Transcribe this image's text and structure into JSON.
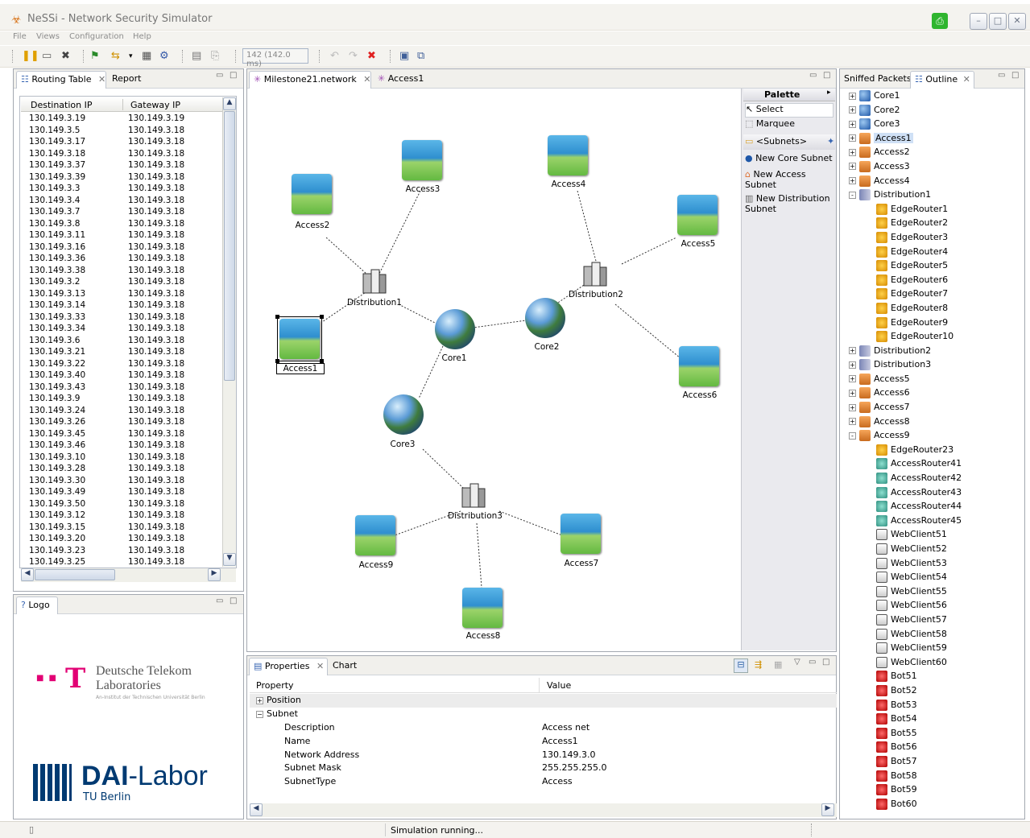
{
  "window": {
    "title": "NeSSi - Network Security Simulator"
  },
  "menu": [
    "File",
    "Views",
    "Configuration",
    "Help"
  ],
  "toolbar": {
    "speed_label": "142 (142.0 ms)"
  },
  "routing_panel": {
    "tabs": [
      "Routing Table",
      "Report"
    ],
    "columns": [
      "Destination IP",
      "Gateway IP"
    ],
    "rows": [
      [
        "130.149.3.19",
        "130.149.3.19"
      ],
      [
        "130.149.3.5",
        "130.149.3.18"
      ],
      [
        "130.149.3.17",
        "130.149.3.18"
      ],
      [
        "130.149.3.18",
        "130.149.3.18"
      ],
      [
        "130.149.3.37",
        "130.149.3.18"
      ],
      [
        "130.149.3.39",
        "130.149.3.18"
      ],
      [
        "130.149.3.3",
        "130.149.3.18"
      ],
      [
        "130.149.3.4",
        "130.149.3.18"
      ],
      [
        "130.149.3.7",
        "130.149.3.18"
      ],
      [
        "130.149.3.8",
        "130.149.3.18"
      ],
      [
        "130.149.3.11",
        "130.149.3.18"
      ],
      [
        "130.149.3.16",
        "130.149.3.18"
      ],
      [
        "130.149.3.36",
        "130.149.3.18"
      ],
      [
        "130.149.3.38",
        "130.149.3.18"
      ],
      [
        "130.149.3.2",
        "130.149.3.18"
      ],
      [
        "130.149.3.13",
        "130.149.3.18"
      ],
      [
        "130.149.3.14",
        "130.149.3.18"
      ],
      [
        "130.149.3.33",
        "130.149.3.18"
      ],
      [
        "130.149.3.34",
        "130.149.3.18"
      ],
      [
        "130.149.3.6",
        "130.149.3.18"
      ],
      [
        "130.149.3.21",
        "130.149.3.18"
      ],
      [
        "130.149.3.22",
        "130.149.3.18"
      ],
      [
        "130.149.3.40",
        "130.149.3.18"
      ],
      [
        "130.149.3.43",
        "130.149.3.18"
      ],
      [
        "130.149.3.9",
        "130.149.3.18"
      ],
      [
        "130.149.3.24",
        "130.149.3.18"
      ],
      [
        "130.149.3.26",
        "130.149.3.18"
      ],
      [
        "130.149.3.45",
        "130.149.3.18"
      ],
      [
        "130.149.3.46",
        "130.149.3.18"
      ],
      [
        "130.149.3.10",
        "130.149.3.18"
      ],
      [
        "130.149.3.28",
        "130.149.3.18"
      ],
      [
        "130.149.3.30",
        "130.149.3.18"
      ],
      [
        "130.149.3.49",
        "130.149.3.18"
      ],
      [
        "130.149.3.50",
        "130.149.3.18"
      ],
      [
        "130.149.3.12",
        "130.149.3.18"
      ],
      [
        "130.149.3.15",
        "130.149.3.18"
      ],
      [
        "130.149.3.20",
        "130.149.3.18"
      ],
      [
        "130.149.3.23",
        "130.149.3.18"
      ],
      [
        "130.149.3.25",
        "130.149.3.18"
      ]
    ]
  },
  "logo_panel": {
    "tab": "Logo",
    "telekom_line1": "Deutsche Telekom",
    "telekom_line2": "Laboratories",
    "telekom_sub": "An-Institut der Technischen Universität Berlin",
    "dai_bold": "DAI",
    "dai_rest": "-Labor",
    "dai_sub": "TU Berlin"
  },
  "editor": {
    "tabs": [
      "Milestone21.network",
      "Access1"
    ],
    "nodes": {
      "access1": "Access1",
      "access2": "Access2",
      "access3": "Access3",
      "access4": "Access4",
      "access5": "Access5",
      "access6": "Access6",
      "access7": "Access7",
      "access8": "Access8",
      "access9": "Access9",
      "core1": "Core1",
      "core2": "Core2",
      "core3": "Core3",
      "dist1": "Distribution1",
      "dist2": "Distribution2",
      "dist3": "Distribution3"
    }
  },
  "palette": {
    "title": "Palette",
    "select": "Select",
    "marquee": "Marquee",
    "subnets": "<Subnets>",
    "new_core": "New Core Subnet",
    "new_access": "New Access Subnet",
    "new_distribution": "New Distribution Subnet"
  },
  "properties": {
    "tabs": [
      "Properties",
      "Chart"
    ],
    "columns": [
      "Property",
      "Value"
    ],
    "position": "Position",
    "subnet": "Subnet",
    "rows": [
      [
        "Description",
        "Access net"
      ],
      [
        "Name",
        "Access1"
      ],
      [
        "Network Address",
        "130.149.3.0"
      ],
      [
        "Subnet Mask",
        "255.255.255.0"
      ],
      [
        "SubnetType",
        "Access"
      ]
    ]
  },
  "outline": {
    "tabs": [
      "Sniffed Packets",
      "Outline"
    ],
    "items": [
      {
        "label": "Core1",
        "type": "core",
        "expander": "+",
        "indent": 0
      },
      {
        "label": "Core2",
        "type": "core",
        "expander": "+",
        "indent": 0
      },
      {
        "label": "Core3",
        "type": "core",
        "expander": "+",
        "indent": 0
      },
      {
        "label": "Access1",
        "type": "access",
        "expander": "+",
        "indent": 0
      },
      {
        "label": "Access2",
        "type": "access",
        "expander": "+",
        "indent": 0
      },
      {
        "label": "Access3",
        "type": "access",
        "expander": "+",
        "indent": 0
      },
      {
        "label": "Access4",
        "type": "access",
        "expander": "+",
        "indent": 0
      },
      {
        "label": "Distribution1",
        "type": "dist",
        "expander": "-",
        "indent": 0
      },
      {
        "label": "EdgeRouter1",
        "type": "edge",
        "expander": "",
        "indent": 1
      },
      {
        "label": "EdgeRouter2",
        "type": "edge",
        "expander": "",
        "indent": 1
      },
      {
        "label": "EdgeRouter3",
        "type": "edge",
        "expander": "",
        "indent": 1
      },
      {
        "label": "EdgeRouter4",
        "type": "edge",
        "expander": "",
        "indent": 1
      },
      {
        "label": "EdgeRouter5",
        "type": "edge",
        "expander": "",
        "indent": 1
      },
      {
        "label": "EdgeRouter6",
        "type": "edge",
        "expander": "",
        "indent": 1
      },
      {
        "label": "EdgeRouter7",
        "type": "edge",
        "expander": "",
        "indent": 1
      },
      {
        "label": "EdgeRouter8",
        "type": "edge",
        "expander": "",
        "indent": 1
      },
      {
        "label": "EdgeRouter9",
        "type": "edge",
        "expander": "",
        "indent": 1
      },
      {
        "label": "EdgeRouter10",
        "type": "edge",
        "expander": "",
        "indent": 1
      },
      {
        "label": "Distribution2",
        "type": "dist",
        "expander": "+",
        "indent": 0
      },
      {
        "label": "Distribution3",
        "type": "dist",
        "expander": "+",
        "indent": 0
      },
      {
        "label": "Access5",
        "type": "access",
        "expander": "+",
        "indent": 0
      },
      {
        "label": "Access6",
        "type": "access",
        "expander": "+",
        "indent": 0
      },
      {
        "label": "Access7",
        "type": "access",
        "expander": "+",
        "indent": 0
      },
      {
        "label": "Access8",
        "type": "access",
        "expander": "+",
        "indent": 0
      },
      {
        "label": "Access9",
        "type": "access",
        "expander": "-",
        "indent": 0
      },
      {
        "label": "EdgeRouter23",
        "type": "edge",
        "expander": "",
        "indent": 1
      },
      {
        "label": "AccessRouter41",
        "type": "arouter",
        "expander": "",
        "indent": 1
      },
      {
        "label": "AccessRouter42",
        "type": "arouter",
        "expander": "",
        "indent": 1
      },
      {
        "label": "AccessRouter43",
        "type": "arouter",
        "expander": "",
        "indent": 1
      },
      {
        "label": "AccessRouter44",
        "type": "arouter",
        "expander": "",
        "indent": 1
      },
      {
        "label": "AccessRouter45",
        "type": "arouter",
        "expander": "",
        "indent": 1
      },
      {
        "label": "WebClient51",
        "type": "client",
        "expander": "",
        "indent": 1
      },
      {
        "label": "WebClient52",
        "type": "client",
        "expander": "",
        "indent": 1
      },
      {
        "label": "WebClient53",
        "type": "client",
        "expander": "",
        "indent": 1
      },
      {
        "label": "WebClient54",
        "type": "client",
        "expander": "",
        "indent": 1
      },
      {
        "label": "WebClient55",
        "type": "client",
        "expander": "",
        "indent": 1
      },
      {
        "label": "WebClient56",
        "type": "client",
        "expander": "",
        "indent": 1
      },
      {
        "label": "WebClient57",
        "type": "client",
        "expander": "",
        "indent": 1
      },
      {
        "label": "WebClient58",
        "type": "client",
        "expander": "",
        "indent": 1
      },
      {
        "label": "WebClient59",
        "type": "client",
        "expander": "",
        "indent": 1
      },
      {
        "label": "WebClient60",
        "type": "client",
        "expander": "",
        "indent": 1
      },
      {
        "label": "Bot51",
        "type": "bot",
        "expander": "",
        "indent": 1
      },
      {
        "label": "Bot52",
        "type": "bot",
        "expander": "",
        "indent": 1
      },
      {
        "label": "Bot53",
        "type": "bot",
        "expander": "",
        "indent": 1
      },
      {
        "label": "Bot54",
        "type": "bot",
        "expander": "",
        "indent": 1
      },
      {
        "label": "Bot55",
        "type": "bot",
        "expander": "",
        "indent": 1
      },
      {
        "label": "Bot56",
        "type": "bot",
        "expander": "",
        "indent": 1
      },
      {
        "label": "Bot57",
        "type": "bot",
        "expander": "",
        "indent": 1
      },
      {
        "label": "Bot58",
        "type": "bot",
        "expander": "",
        "indent": 1
      },
      {
        "label": "Bot59",
        "type": "bot",
        "expander": "",
        "indent": 1
      },
      {
        "label": "Bot60",
        "type": "bot",
        "expander": "",
        "indent": 1
      }
    ]
  },
  "status": {
    "text": "Simulation running..."
  },
  "colors": {
    "telekom_magenta": "#e20074",
    "dai_blue": "#003a72",
    "selection": "#cfe0f5"
  }
}
